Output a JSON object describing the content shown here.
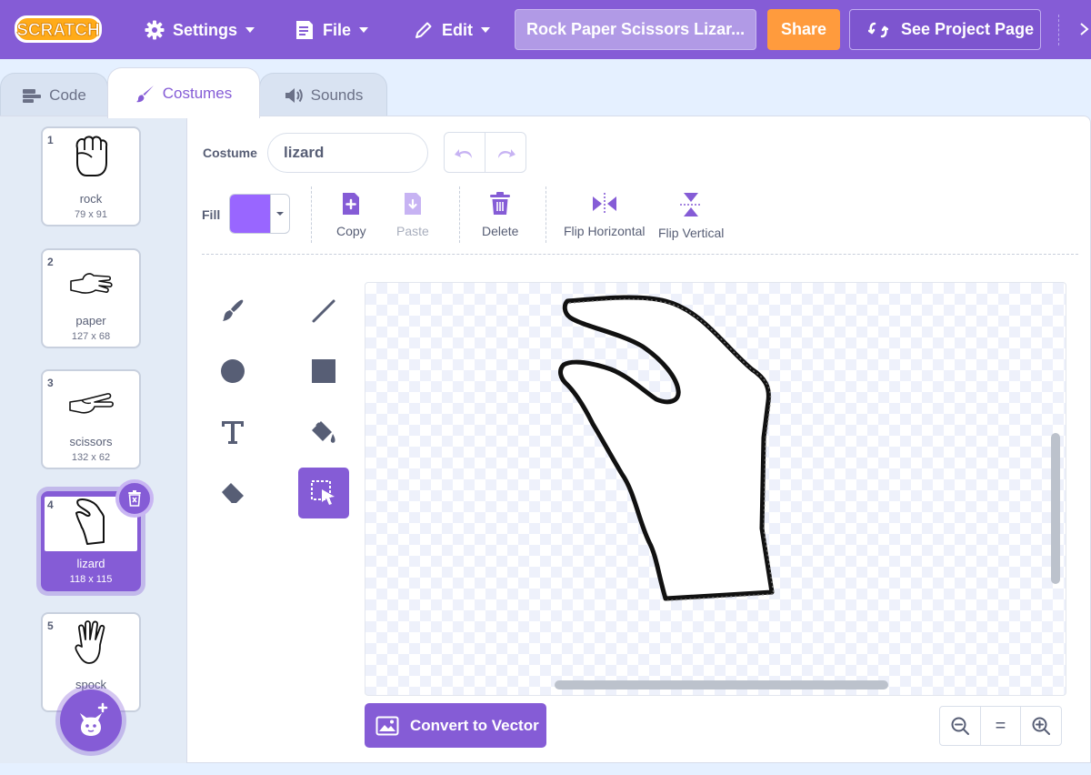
{
  "menubar": {
    "logo_text": "SCRATCH",
    "settings_label": "Settings",
    "file_label": "File",
    "edit_label": "Edit",
    "project_title": "Rock Paper Scissors Lizar...",
    "share_label": "Share",
    "see_project_label": "See Project Page"
  },
  "tabs": [
    {
      "label": "Code",
      "icon": "code-icon"
    },
    {
      "label": "Costumes",
      "icon": "paintbrush-icon",
      "active": true
    },
    {
      "label": "Sounds",
      "icon": "speaker-icon"
    }
  ],
  "costumes": [
    {
      "number": "1",
      "name": "rock",
      "size": "79 x 91"
    },
    {
      "number": "2",
      "name": "paper",
      "size": "127 x 68"
    },
    {
      "number": "3",
      "name": "scissors",
      "size": "132 x 62"
    },
    {
      "number": "4",
      "name": "lizard",
      "size": "118 x 115",
      "selected": true
    },
    {
      "number": "5",
      "name": "spock",
      "size": ""
    }
  ],
  "editor": {
    "costume_label": "Costume",
    "costume_name": "lizard",
    "fill_label": "Fill",
    "fill_color": "#9966ff",
    "copy_label": "Copy",
    "paste_label": "Paste",
    "delete_label": "Delete",
    "flip_h_label": "Flip Horizontal",
    "flip_v_label": "Flip Vertical",
    "convert_label": "Convert to Vector",
    "zoom_reset_label": "="
  },
  "colors": {
    "accent": "#855cd6",
    "share": "#ff9b3d",
    "text": "#575e75"
  }
}
